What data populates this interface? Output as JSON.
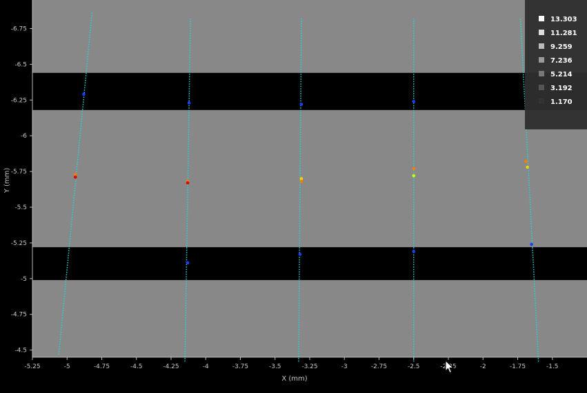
{
  "chart_data": {
    "type": "scatter",
    "title": "",
    "xlabel": "X (mm)",
    "ylabel": "Y (mm)",
    "xlim": [
      -5.25,
      -1.25
    ],
    "ylim": [
      -4.45,
      -6.95
    ],
    "y_axis_inverted": true,
    "grid": false,
    "x_ticks": [
      "-5.25",
      "-5",
      "-4.75",
      "-4.5",
      "-4.25",
      "-4",
      "-3.75",
      "-3.5",
      "-3.25",
      "-3",
      "-2.75",
      "-2.5",
      "-2.25",
      "-2",
      "-1.75",
      "-1.5"
    ],
    "y_ticks": [
      "-6.75",
      "-6.5",
      "-6.25",
      "-6",
      "-5.75",
      "-5.5",
      "-5.25",
      "-5",
      "-4.75",
      "-4.5"
    ],
    "legend": {
      "placement": "top-right",
      "entries": [
        "13.303",
        "11.281",
        "9.259",
        "7.236",
        "5.214",
        "3.192",
        "1.170"
      ],
      "swatch_colors": [
        "#ffffff",
        "#dddddd",
        "#bbbbbb",
        "#999999",
        "#777777",
        "#555555",
        "#333333"
      ]
    },
    "background": {
      "field_color": "#888888",
      "band_color": "#000000",
      "bands": [
        {
          "x": [
            -5.25,
            -1.25
          ],
          "y": [
            -6.18,
            -6.44
          ]
        },
        {
          "x": [
            -5.25,
            -1.25
          ],
          "y": [
            -4.99,
            -5.22
          ]
        }
      ]
    },
    "scan_lines": [
      {
        "name": "",
        "color": "#1ed8e0",
        "points": [
          [
            -5.06,
            -4.47
          ],
          [
            -4.82,
            -6.86
          ]
        ]
      },
      {
        "name": "",
        "color": "#1ed8e0",
        "points": [
          [
            -4.15,
            -4.42
          ],
          [
            -4.11,
            -6.82
          ]
        ]
      },
      {
        "name": "",
        "color": "#1ed8e0",
        "points": [
          [
            -3.33,
            -4.42
          ],
          [
            -3.31,
            -6.82
          ]
        ]
      },
      {
        "name": "",
        "color": "#1ed8e0",
        "points": [
          [
            -2.5,
            -4.42
          ],
          [
            -2.5,
            -6.82
          ]
        ]
      },
      {
        "name": "",
        "color": "#1ed8e0",
        "points": [
          [
            -1.6,
            -4.42
          ],
          [
            -1.73,
            -6.82
          ]
        ]
      }
    ],
    "points": [
      {
        "x": -4.88,
        "y": -6.29,
        "color": "#1e3cff"
      },
      {
        "x": -4.12,
        "y": -6.23,
        "color": "#1e3cff"
      },
      {
        "x": -3.31,
        "y": -6.22,
        "color": "#1e3cff"
      },
      {
        "x": -2.5,
        "y": -6.24,
        "color": "#1e3cff"
      },
      {
        "x": -4.94,
        "y": -5.73,
        "color": "#ff7a00"
      },
      {
        "x": -4.94,
        "y": -5.71,
        "color": "#e00000"
      },
      {
        "x": -4.13,
        "y": -5.68,
        "color": "#ff7a00"
      },
      {
        "x": -4.13,
        "y": -5.67,
        "color": "#e00000"
      },
      {
        "x": -3.31,
        "y": -5.7,
        "color": "#ffd000"
      },
      {
        "x": -3.31,
        "y": -5.68,
        "color": "#ff7a00"
      },
      {
        "x": -2.5,
        "y": -5.77,
        "color": "#ff7a00"
      },
      {
        "x": -2.5,
        "y": -5.72,
        "color": "#c8ff00"
      },
      {
        "x": -1.69,
        "y": -5.82,
        "color": "#ff7a00"
      },
      {
        "x": -1.68,
        "y": -5.78,
        "color": "#ffd000"
      },
      {
        "x": -4.13,
        "y": -5.11,
        "color": "#1e3cff"
      },
      {
        "x": -3.32,
        "y": -5.17,
        "color": "#1e3cff"
      },
      {
        "x": -2.5,
        "y": -5.19,
        "color": "#1e3cff"
      },
      {
        "x": -1.65,
        "y": -5.24,
        "color": "#1e3cff"
      }
    ]
  }
}
